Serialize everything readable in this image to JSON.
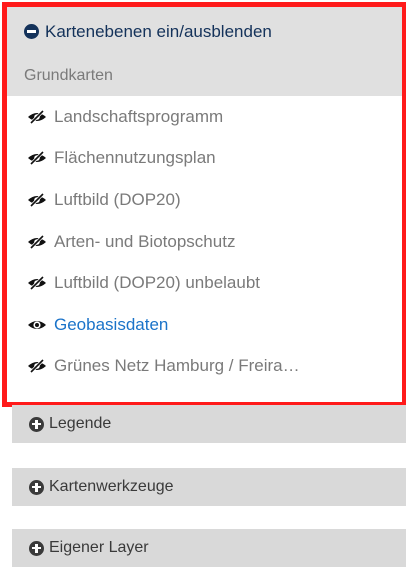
{
  "panel": {
    "title": "Kartenebenen ein/ausblenden",
    "group": "Grundkarten",
    "layers": [
      {
        "label": "Landschaftsprogramm",
        "visible": false
      },
      {
        "label": "Flächennutzungsplan",
        "visible": false
      },
      {
        "label": "Luftbild (DOP20)",
        "visible": false
      },
      {
        "label": "Arten- und Biotopschutz",
        "visible": false
      },
      {
        "label": "Luftbild (DOP20) unbelaubt",
        "visible": false
      },
      {
        "label": "Geobasisdaten",
        "visible": true
      },
      {
        "label": "Grünes Netz Hamburg / Freira…",
        "visible": false
      }
    ]
  },
  "sections": {
    "legend": "Legende",
    "tools": "Kartenwerkzeuge",
    "own_layer": "Eigener Layer"
  },
  "icons": {
    "header": "minus-circle-icon",
    "hidden": "eye-slash-icon",
    "visible": "eye-icon",
    "section": "plus-circle-icon"
  },
  "colors": {
    "highlight_border": "#ff1a1a",
    "header_text": "#14325a",
    "active_layer": "#1a73c9",
    "inactive_layer": "#7a7a7a"
  }
}
